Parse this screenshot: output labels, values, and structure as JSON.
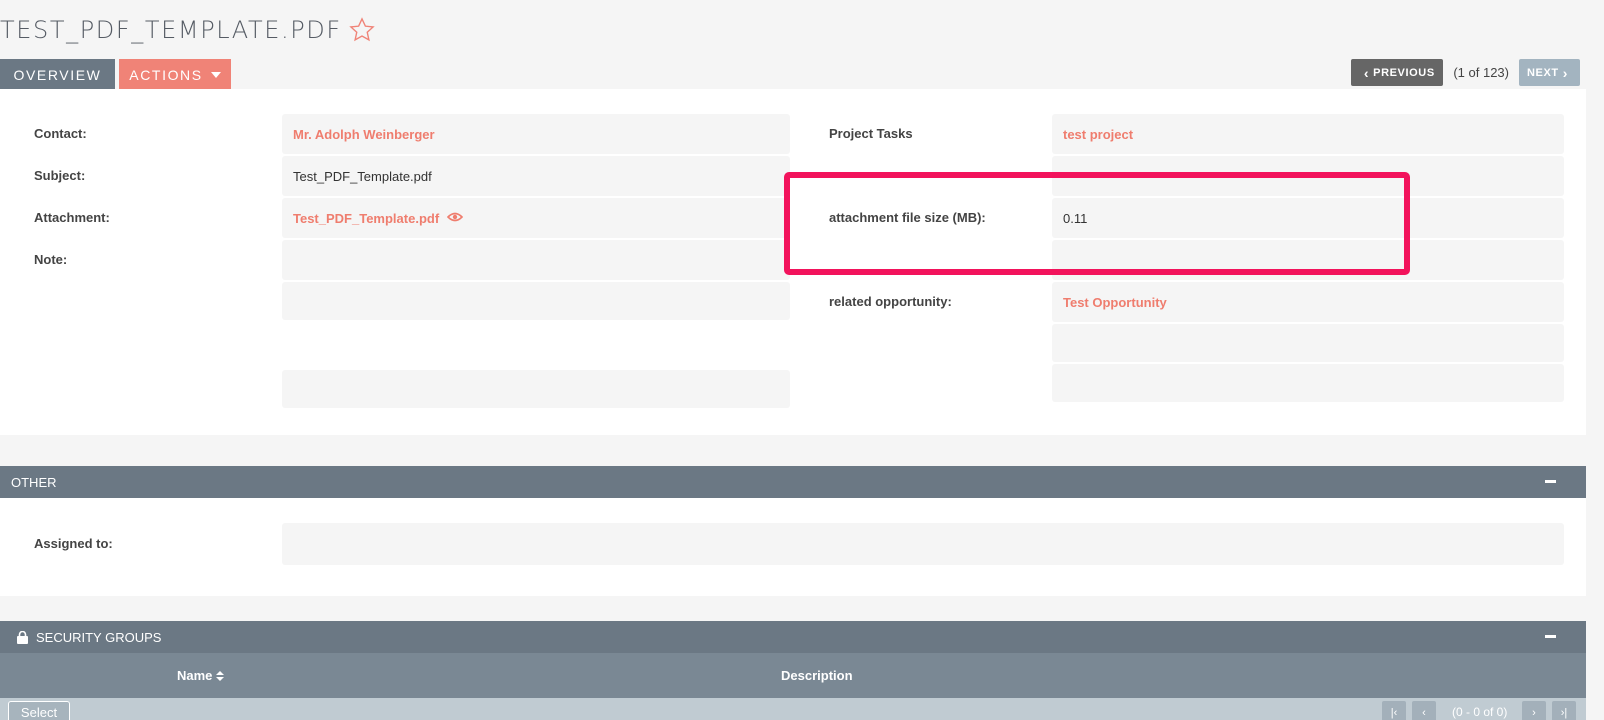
{
  "page": {
    "title": "TEST_PDF_TEMPLATE.PDF",
    "star_icon": "star-outline-icon"
  },
  "tabs": {
    "overview": "OVERVIEW",
    "actions": "ACTIONS"
  },
  "pager": {
    "previous": "PREVIOUS",
    "count": "(1 of 123)",
    "next": "NEXT"
  },
  "overview": {
    "contact_label": "Contact:",
    "contact_value": "Mr. Adolph Weinberger",
    "subject_label": "Subject:",
    "subject_value": "Test_PDF_Template.pdf",
    "attachment_label": "Attachment:",
    "attachment_value": "Test_PDF_Template.pdf",
    "note_label": "Note:",
    "project_tasks_label": "Project Tasks",
    "project_tasks_value": "test project",
    "file_size_label": "attachment file size (MB):",
    "file_size_value": "0.11",
    "related_opp_label": "related opportunity:",
    "related_opp_value": "Test Opportunity"
  },
  "other": {
    "header": "OTHER",
    "assigned_label": "Assigned to:"
  },
  "security": {
    "header": "SECURITY GROUPS",
    "col_name": "Name",
    "col_description": "Description",
    "select": "Select",
    "page_text": "(0 - 0 of 0)"
  },
  "colors": {
    "accent": "#f08377",
    "header_bar": "#6b7884",
    "highlight": "#f2135c"
  }
}
